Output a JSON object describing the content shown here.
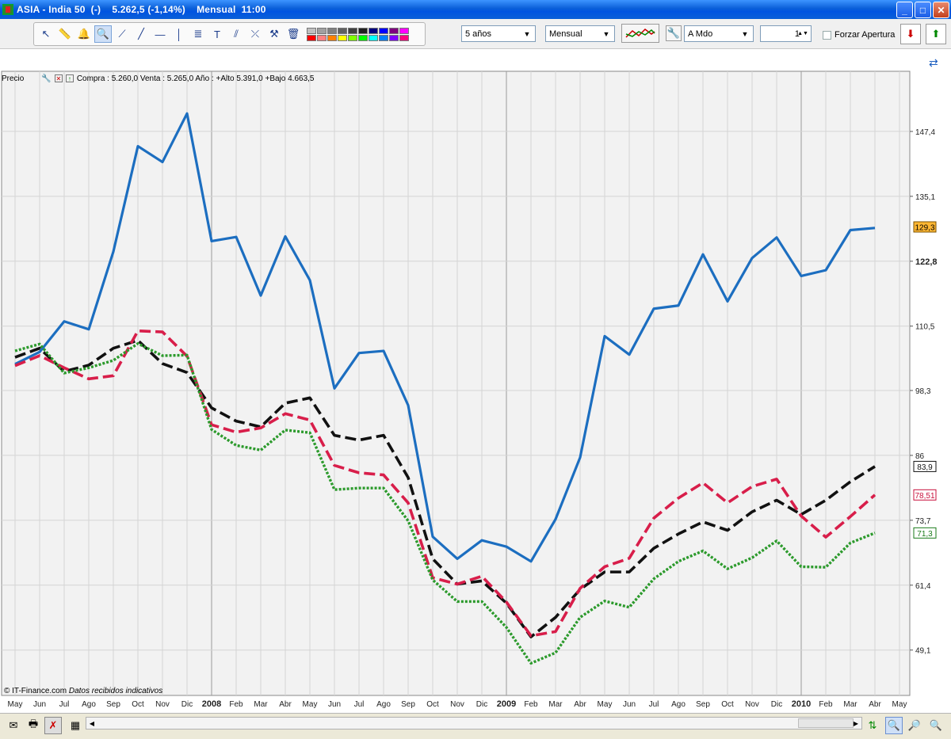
{
  "window": {
    "title": "ASIA - India 50  (-)    5.262,5 (-1,14%)    Mensual  11:00",
    "minimize": "_",
    "maximize": "□",
    "close": "✕"
  },
  "toolbar": {
    "period_select": "5 años",
    "interval_select": "Mensual",
    "mode_select": "A Mdo",
    "count_value": "1",
    "forzar_apertura": "Forzar Apertura",
    "tools": [
      "pointer-icon",
      "ruler-icon",
      "alarm-icon",
      "zoom-icon",
      "line-icon",
      "trend-icon",
      "hline-icon",
      "vline-icon",
      "fibonacci-icon",
      "text-icon",
      "channel-icon",
      "fan-icon",
      "tools-icon",
      "trash-icon"
    ],
    "palette": [
      "#c0c0c0",
      "#a0a0a0",
      "#808080",
      "#606060",
      "#404040",
      "#202020",
      "#000080",
      "#0000ff",
      "#800080",
      "#ff00ff",
      "#ff0000",
      "#ff8080",
      "#ff8000",
      "#ffff00",
      "#80ff00",
      "#00ff00",
      "#00ffff",
      "#0080ff",
      "#8000ff",
      "#ff0080"
    ]
  },
  "info": {
    "label": "Precio",
    "text": "Compra : 5.260,0 Venta : 5.265,0  Año : +Alto 5.391,0 +Bajo 4.663,5"
  },
  "footer": {
    "copyright": "© IT-Finance.com",
    "note": "Datos recibidos indicativos"
  },
  "chart_data": {
    "type": "line",
    "x": [
      "May",
      "Jun",
      "Jul",
      "Ago",
      "Sep",
      "Oct",
      "Nov",
      "Dic",
      "2008",
      "Feb",
      "Mar",
      "Abr",
      "May",
      "Jun",
      "Jul",
      "Ago",
      "Sep",
      "Oct",
      "Nov",
      "Dic",
      "2009",
      "Feb",
      "Mar",
      "Abr",
      "May",
      "Jun",
      "Jul",
      "Ago",
      "Sep",
      "Oct",
      "Nov",
      "Dic",
      "2010",
      "Feb",
      "Mar",
      "Abr",
      "May"
    ],
    "bold_ticks": [
      "2008",
      "2009",
      "2010"
    ],
    "yticks": [
      49.1,
      61.4,
      73.7,
      86,
      98.3,
      110.5,
      122.8,
      135.1,
      147.4
    ],
    "ytick_labels": [
      "49,1",
      "61,4",
      "73,7",
      "86",
      "98,3",
      "110,5",
      "122,8",
      "135,1",
      "147,4"
    ],
    "bold_ytick": "122,8",
    "ylim": [
      40.5,
      158.8
    ],
    "grid": true,
    "series": [
      {
        "color": "#1c6ec0",
        "style": "solid",
        "width": 3.2,
        "values": [
          103.3,
          105.6,
          111.4,
          109.9,
          124.6,
          144.6,
          141.6,
          150.8,
          126.6,
          127.4,
          116.3,
          127.5,
          119.2,
          98.7,
          105.4,
          105.8,
          95.5,
          70.6,
          66.4,
          69.9,
          68.7,
          65.9,
          73.9,
          85.6,
          108.6,
          105.1,
          113.8,
          114.4,
          124.1,
          115.2,
          123.4,
          127.3,
          120.0,
          121.1,
          128.7,
          129.1
        ]
      },
      {
        "color": "#111111",
        "style": "dash",
        "width": 3.6,
        "values": [
          104.6,
          106.3,
          101.9,
          103.1,
          106.3,
          107.8,
          103.4,
          101.7,
          95.0,
          92.5,
          91.4,
          95.9,
          96.9,
          89.8,
          88.9,
          89.8,
          81.8,
          66.4,
          61.6,
          62.2,
          58.0,
          51.6,
          55.3,
          60.6,
          63.9,
          63.9,
          68.4,
          71.1,
          73.4,
          71.8,
          75.3,
          77.5,
          74.8,
          77.5,
          81.0,
          83.9
        ]
      },
      {
        "color": "#d81e4a",
        "style": "dash",
        "width": 3.6,
        "values": [
          103.0,
          104.9,
          102.6,
          100.5,
          101.1,
          109.6,
          109.4,
          104.8,
          91.8,
          90.4,
          91.2,
          93.9,
          92.7,
          84.1,
          82.7,
          82.3,
          77.0,
          62.8,
          61.6,
          63.1,
          58.2,
          51.8,
          52.6,
          60.8,
          64.9,
          66.5,
          74.1,
          77.9,
          80.8,
          77.0,
          80.1,
          81.5,
          74.5,
          70.5,
          74.4,
          78.51
        ]
      },
      {
        "color": "#2c9a2c",
        "style": "dot",
        "width": 3.4,
        "values": [
          105.8,
          107.1,
          101.6,
          102.6,
          104.0,
          107.2,
          104.9,
          105.0,
          90.9,
          87.9,
          87.0,
          90.8,
          90.3,
          79.5,
          79.8,
          79.8,
          73.6,
          62.4,
          58.3,
          58.3,
          53.4,
          46.6,
          48.6,
          55.3,
          58.4,
          57.2,
          62.6,
          65.9,
          67.9,
          64.5,
          66.6,
          69.8,
          64.9,
          64.8,
          69.4,
          71.3
        ]
      }
    ],
    "last_labels": [
      {
        "text": "129,3",
        "value": 129.3,
        "bg": "#ffb733",
        "fg": "#000",
        "border": "#7a5200"
      },
      {
        "text": "83,9",
        "value": 83.9,
        "bg": "#ffffff",
        "fg": "#111",
        "border": "#111"
      },
      {
        "text": "78,51",
        "value": 78.51,
        "bg": "#ffffff",
        "fg": "#c8103c",
        "border": "#c8103c"
      },
      {
        "text": "71,3",
        "value": 71.3,
        "bg": "#ffffff",
        "fg": "#1a7a1a",
        "border": "#1a7a1a"
      }
    ]
  }
}
